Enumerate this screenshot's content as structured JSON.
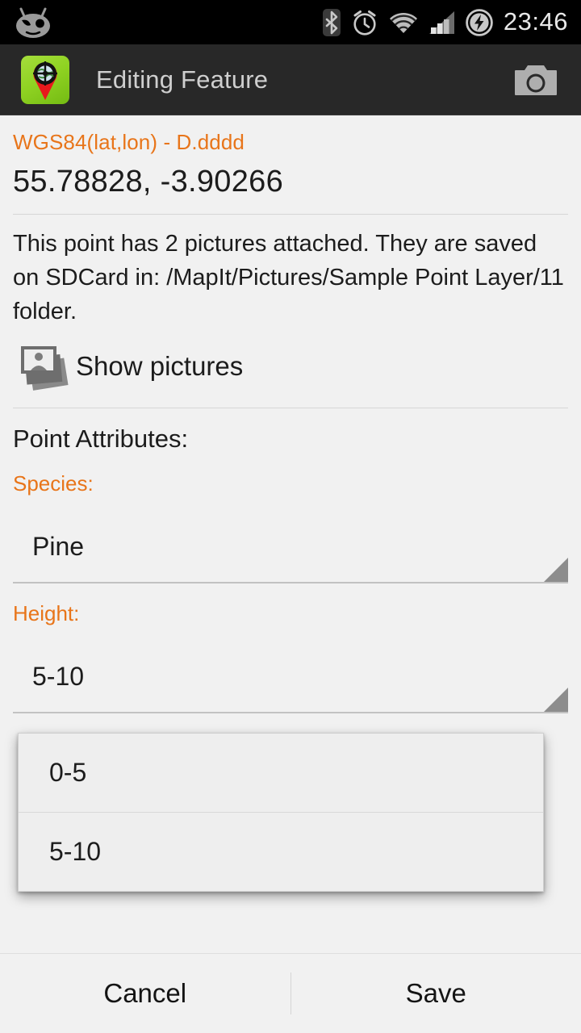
{
  "status_bar": {
    "logo_icon": "cyanogenmod-logo",
    "icons": [
      "bluetooth-icon",
      "alarm-icon",
      "wifi-icon",
      "signal-icon",
      "battery-charging-icon"
    ],
    "clock": "23:46"
  },
  "action_bar": {
    "app_icon": "mapit-app-icon",
    "title": "Editing Feature",
    "camera_icon": "camera-icon"
  },
  "main": {
    "crs_label": "WGS84(lat,lon) - D.dddd",
    "coordinates": "55.78828, -3.90266",
    "pictures_note": "This point has 2 pictures attached. They are saved on SDCard in: /MapIt/Pictures/Sample Point Layer/11 folder.",
    "show_pictures_label": "Show pictures",
    "show_pictures_icon": "gallery-stack-icon",
    "attributes_heading": "Point Attributes:",
    "fields": [
      {
        "label": "Species:",
        "value": "Pine"
      },
      {
        "label": "Height:",
        "value": "5-10"
      }
    ]
  },
  "dropdown": {
    "open_for": "Height:",
    "options": [
      "0-5",
      "5-10"
    ]
  },
  "bottom_bar": {
    "cancel_label": "Cancel",
    "save_label": "Save"
  },
  "colors": {
    "accent_orange": "#e8751a",
    "background": "#f1f1f1",
    "action_bar": "#282828",
    "status_bar": "#000000",
    "text_primary": "#1c1c1c"
  }
}
